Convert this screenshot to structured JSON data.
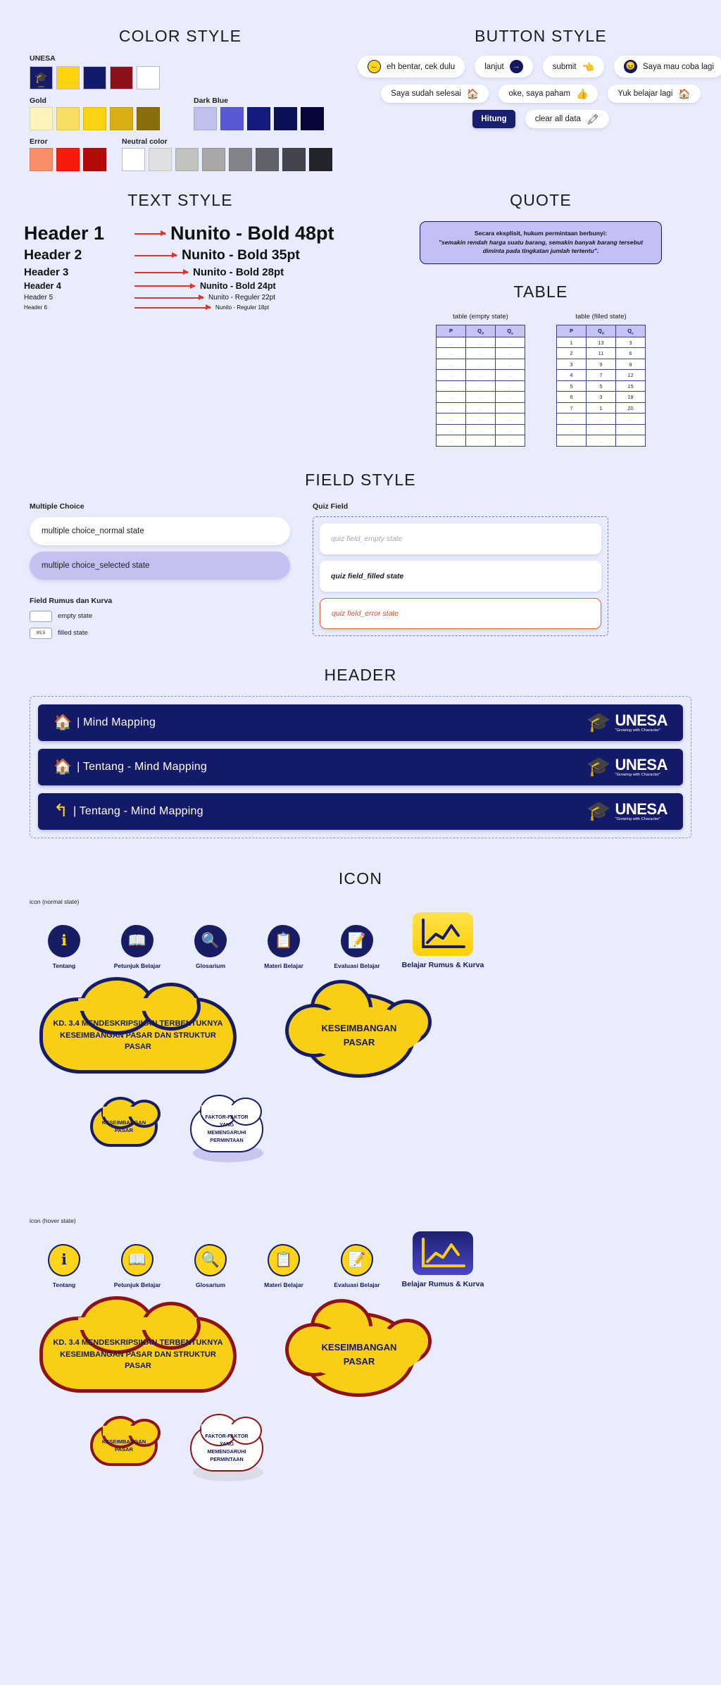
{
  "sections": {
    "color_style": "COLOR STYLE",
    "button_style": "BUTTON STYLE",
    "text_style": "TEXT STYLE",
    "quote": "QUOTE",
    "table": "TABLE",
    "field_style": "FIELD STYLE",
    "header": "HEADER",
    "icon": "ICON"
  },
  "color_style": {
    "groups": [
      {
        "label": "UNESA",
        "swatches": [
          "#1a1f6e",
          "#ffd40d",
          "#121a6e",
          "#8c1018",
          "#ffffff"
        ]
      },
      {
        "label": "Gold",
        "swatches": [
          "#fcf4bd",
          "#f8de63",
          "#fcd211",
          "#d9b013",
          "#8a6e0d"
        ]
      },
      {
        "label": "Dark Blue",
        "swatches": [
          "#bfc0ee",
          "#5a59d4",
          "#161a7e",
          "#0c1057",
          "#05063a"
        ]
      },
      {
        "label": "Error",
        "swatches": [
          "#f98e68",
          "#f71b0b",
          "#b50a0a"
        ]
      },
      {
        "label": "Neutral color",
        "swatches": [
          "#ffffff",
          "#e0e0de",
          "#c2c2bf",
          "#a8a8a6",
          "#83838a",
          "#62626b",
          "#44444e",
          "#23232c"
        ]
      }
    ]
  },
  "buttons": {
    "row1": [
      {
        "label": "eh bentar, cek dulu",
        "icon": "arrow-left-circle-icon",
        "icon_pos": "left",
        "icon_style": "gold"
      },
      {
        "label": "lanjut",
        "icon": "arrow-right-circle-icon",
        "icon_pos": "right",
        "icon_style": "navy"
      },
      {
        "label": "submit",
        "icon": "pointer-hand-icon",
        "icon_pos": "right",
        "icon_style": "emoji"
      },
      {
        "label": "Saya mau coba lagi",
        "icon": "confounded-face-icon",
        "icon_pos": "left",
        "icon_style": "navy"
      }
    ],
    "row2": [
      {
        "label": "Saya sudah selesai",
        "icon": "home-icon",
        "icon_pos": "right",
        "icon_style": "emoji"
      },
      {
        "label": "oke, saya paham",
        "icon": "thumbs-up-icon",
        "icon_pos": "right",
        "icon_style": "emoji"
      },
      {
        "label": "Yuk belajar lagi",
        "icon": "home-icon",
        "icon_pos": "right",
        "icon_style": "emoji"
      }
    ],
    "row3": [
      {
        "label": "Hitung",
        "icon": "",
        "type": "dark"
      },
      {
        "label": "clear all data",
        "icon": "eraser-icon",
        "icon_pos": "right",
        "icon_style": "emoji"
      }
    ]
  },
  "quote": {
    "line1": "Secara eksplisit, hukum permintaan berbunyi:",
    "line2": "\"semakin rendah harga suatu barang, semakin banyak barang tersebut diminta pada tingkatan jumlah tertentu\"."
  },
  "text_style": {
    "rows": [
      {
        "left": "Header 1",
        "right": "Nunito - Bold 48pt"
      },
      {
        "left": "Header 2",
        "right": "Nunito - Bold 35pt"
      },
      {
        "left": "Header 3",
        "right": "Nunito - Bold 28pt"
      },
      {
        "left": "Header 4",
        "right": "Nunito - Bold 24pt"
      },
      {
        "left": "Header 5",
        "right": "Nunito - Reguler 22pt"
      },
      {
        "left": "Header 6",
        "right": "Nunito - Reguler 18pt"
      }
    ]
  },
  "tables": {
    "empty": {
      "caption": "table (empty state)",
      "headers": [
        "P",
        "Qd",
        "Qs"
      ],
      "rows": [
        [
          "...",
          "...",
          "..."
        ],
        [
          "...",
          "...",
          "..."
        ],
        [
          "...",
          "...",
          "..."
        ],
        [
          "...",
          "...",
          "..."
        ],
        [
          "...",
          "...",
          "..."
        ],
        [
          "...",
          "...",
          "..."
        ],
        [
          "...",
          "...",
          "..."
        ],
        [
          "...",
          "...",
          "..."
        ],
        [
          "...",
          "...",
          "..."
        ],
        [
          "...",
          "...",
          "..."
        ]
      ]
    },
    "filled": {
      "caption": "table (filled state)",
      "headers": [
        "P",
        "Qd",
        "Qs"
      ],
      "rows": [
        [
          "1",
          "13",
          "3"
        ],
        [
          "2",
          "11",
          "6"
        ],
        [
          "3",
          "9",
          "9"
        ],
        [
          "4",
          "7",
          "12"
        ],
        [
          "5",
          "5",
          "15"
        ],
        [
          "6",
          "3",
          "18"
        ],
        [
          "7",
          "1",
          "20"
        ],
        [
          "...",
          "...",
          "..."
        ],
        [
          "...",
          "...",
          "..."
        ],
        [
          "...",
          "...",
          "..."
        ]
      ]
    }
  },
  "field_style": {
    "multiple_choice_label": "Multiple Choice",
    "mc_normal": "multiple choice_normal state",
    "mc_selected": "multiple choice_selected state",
    "rumus_label": "Field Rumus dan Kurva",
    "rumus_empty_value": "...",
    "rumus_empty_text": "empty state",
    "rumus_filled_value": "89,5",
    "rumus_filled_text": "filled state",
    "quiz_label": "Quiz Field",
    "quiz_empty": "quiz field_empty state",
    "quiz_filled": "quiz field_filled state",
    "quiz_error": "quiz field_error state"
  },
  "headers": {
    "brand_name": "UNESA",
    "brand_tagline": "\"Growing with Character\"",
    "bars": [
      {
        "icon": "home-icon",
        "title": "| Mind Mapping"
      },
      {
        "icon": "home-icon",
        "title": "| Tentang - Mind Mapping"
      },
      {
        "icon": "back-arrow-icon",
        "title": "| Tentang - Mind Mapping"
      }
    ]
  },
  "icons": {
    "normal_state_label": "icon (normal state)",
    "hover_state_label": "icon (hover state)",
    "items": [
      {
        "label": "Tentang",
        "icon": "info-icon",
        "glyph": "ℹ"
      },
      {
        "label": "Petunjuk Belajar",
        "icon": "open-book-icon",
        "glyph": "📖"
      },
      {
        "label": "Glosarium",
        "icon": "magnifier-icon",
        "glyph": "🔍"
      },
      {
        "label": "Materi Belajar",
        "icon": "clipboard-icon",
        "glyph": "📋"
      },
      {
        "label": "Evaluasi Belajar",
        "icon": "document-edit-icon",
        "glyph": "📝"
      }
    ],
    "kurva": {
      "label": "Belajar Rumus & Kurva",
      "icon": "line-chart-icon"
    }
  },
  "clouds": {
    "kd": "KD. 3.4 MENDESKRIPSIKAN TERBENTUKNYA KESEIMBANGAN PASAR DAN STRUKTUR PASAR",
    "keseimbangan_big": "KESEIMBANGAN PASAR",
    "keseimbangan_small": "KESEIMBANGAN PASAR",
    "faktor": "FAKTOR-FAKTOR YANG MEMENGARUHI PERMINTAAN"
  },
  "colors": {
    "background": "#e8ecfc",
    "navy": "#131a68",
    "gold": "#f8cf14",
    "error": "#e0452c",
    "hover_border": "#8e1414",
    "lavender": "#c3c0f2"
  }
}
